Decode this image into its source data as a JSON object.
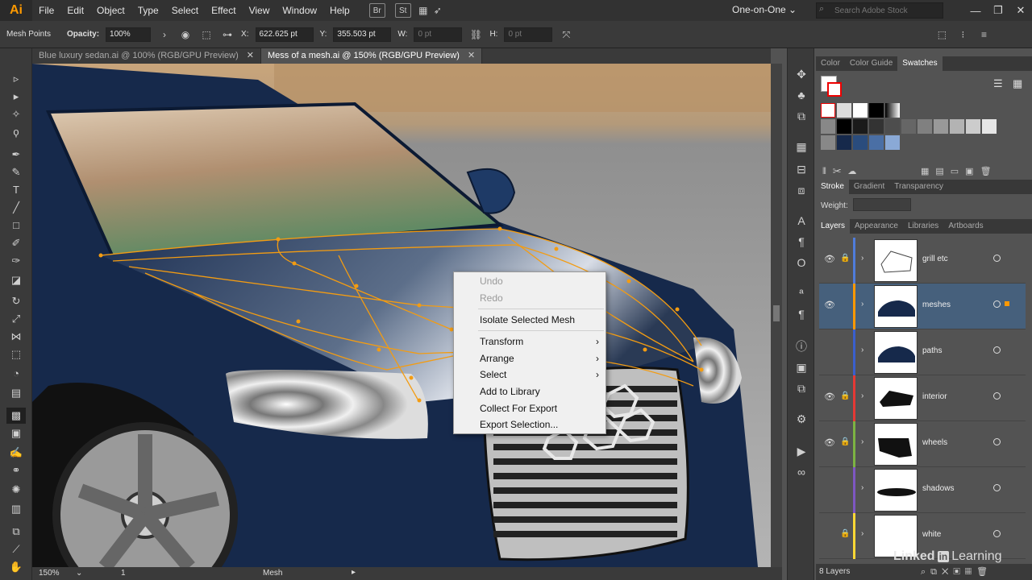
{
  "app": {
    "logo": "Ai"
  },
  "menus": [
    "File",
    "Edit",
    "Object",
    "Type",
    "Select",
    "Effect",
    "View",
    "Window",
    "Help"
  ],
  "menubar_buttons": [
    "Br",
    "St"
  ],
  "workspace": {
    "label": "One-on-One"
  },
  "stock_search": {
    "placeholder": "Search Adobe Stock"
  },
  "control_bar": {
    "selection_label": "Mesh Points",
    "opacity_label": "Opacity:",
    "opacity_value": "100%",
    "x_label": "X:",
    "x_value": "622.625 pt",
    "y_label": "Y:",
    "y_value": "355.503 pt",
    "w_label": "W:",
    "w_value": "0 pt",
    "h_label": "H:",
    "h_value": "0 pt"
  },
  "doc_tabs": [
    {
      "label": "Blue luxury sedan.ai @ 100% (RGB/GPU Preview)",
      "active": false
    },
    {
      "label": "Mess of a mesh.ai @ 150% (RGB/GPU Preview)",
      "active": true
    }
  ],
  "status": {
    "zoom": "150%",
    "artboard": "1",
    "tool": "Mesh"
  },
  "context_menu": {
    "undo": "Undo",
    "redo": "Redo",
    "isolate": "Isolate Selected Mesh",
    "transform": "Transform",
    "arrange": "Arrange",
    "select": "Select",
    "add_library": "Add to Library",
    "collect_export": "Collect For Export",
    "export_selection": "Export Selection..."
  },
  "color_panel": {
    "tabs": [
      "Color",
      "Color Guide",
      "Swatches"
    ]
  },
  "stroke_panel": {
    "tabs": [
      "Stroke",
      "Gradient",
      "Transparency"
    ],
    "weight_label": "Weight:"
  },
  "layers_panel": {
    "tabs": [
      "Layers",
      "Appearance",
      "Libraries",
      "Artboards"
    ],
    "layers": [
      {
        "name": "grill etc",
        "color": "#4f7cdb",
        "visible": true,
        "locked": true,
        "selected": false
      },
      {
        "name": "meshes",
        "color": "#ff9800",
        "visible": true,
        "locked": false,
        "selected": true
      },
      {
        "name": "paths",
        "color": "#3a5fcd",
        "visible": false,
        "locked": false,
        "selected": false
      },
      {
        "name": "interior",
        "color": "#e53935",
        "visible": true,
        "locked": true,
        "selected": false
      },
      {
        "name": "wheels",
        "color": "#7cb342",
        "visible": true,
        "locked": true,
        "selected": false
      },
      {
        "name": "shadows",
        "color": "#7e57c2",
        "visible": false,
        "locked": false,
        "selected": false
      },
      {
        "name": "white",
        "color": "#fdd835",
        "visible": false,
        "locked": true,
        "selected": false
      }
    ],
    "count": "8 Layers"
  },
  "watermark": {
    "brand": "Linked",
    "in": "in",
    "suffix": "Learning"
  }
}
